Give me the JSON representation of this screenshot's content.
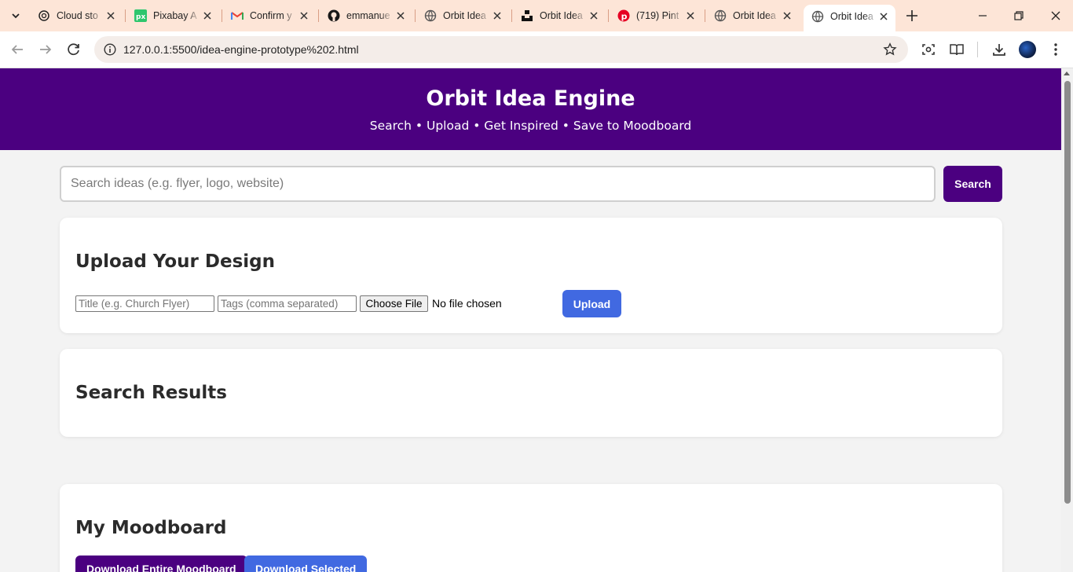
{
  "browser": {
    "tabs": [
      {
        "title": "Cloud sto",
        "favicon": "chatgpt-icon"
      },
      {
        "title": "Pixabay A",
        "favicon": "pixabay-icon"
      },
      {
        "title": "Confirm y",
        "favicon": "gmail-icon"
      },
      {
        "title": "emmanue",
        "favicon": "github-icon"
      },
      {
        "title": "Orbit Idea",
        "favicon": "globe-icon"
      },
      {
        "title": "Orbit Idea",
        "favicon": "unsplash-icon"
      },
      {
        "title": "(719) Pint",
        "favicon": "pinterest-icon"
      },
      {
        "title": "Orbit Idea",
        "favicon": "globe-icon"
      },
      {
        "title": "Orbit Idea",
        "favicon": "globe-icon",
        "active": true
      }
    ],
    "url": "127.0.0.1:5500/idea-engine-prototype%202.html"
  },
  "header": {
    "title": "Orbit Idea Engine",
    "tagline": "Search • Upload • Get Inspired • Save to Moodboard"
  },
  "search": {
    "placeholder": "Search ideas (e.g. flyer, logo, website)",
    "button_label": "Search"
  },
  "upload": {
    "heading": "Upload Your Design",
    "title_placeholder": "Title (e.g. Church Flyer)",
    "tags_placeholder": "Tags (comma separated)",
    "choose_file_label": "Choose File",
    "file_status": "No file chosen",
    "button_label": "Upload"
  },
  "results": {
    "heading": "Search Results"
  },
  "moodboard": {
    "heading": "My Moodboard",
    "download_all_label": "Download Entire Moodboard",
    "download_selected_label": "Download Selected"
  },
  "colors": {
    "brand_purple": "#4b0080",
    "accent_blue": "#4169e1",
    "tabstrip": "#fde5d7"
  }
}
